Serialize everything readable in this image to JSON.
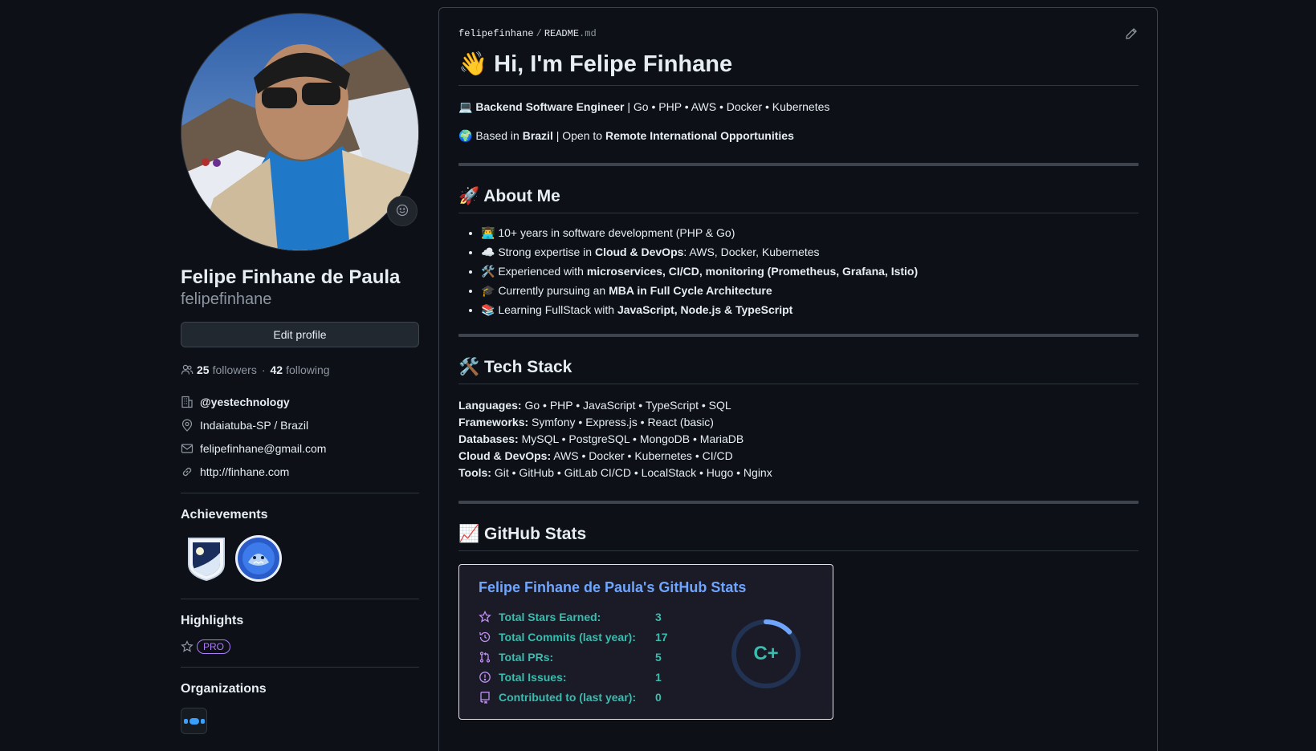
{
  "profile": {
    "full_name": "Felipe Finhane de Paula",
    "username": "felipefinhane",
    "edit_label": "Edit profile",
    "followers_count": "25",
    "followers_label": "followers",
    "following_count": "42",
    "following_label": "following",
    "separator": "·",
    "organization": "@yestechnology",
    "location": "Indaiatuba-SP / Brazil",
    "email": "felipefinhane@gmail.com",
    "website": "http://finhane.com"
  },
  "achievements": {
    "title": "Achievements"
  },
  "highlights": {
    "title": "Highlights",
    "pro_label": "PRO"
  },
  "organizations": {
    "title": "Organizations"
  },
  "readme": {
    "owner": "felipefinhane",
    "slash": "/",
    "file_name": "README",
    "file_ext": ".md",
    "heading": "👋 Hi, I'm Felipe Finhane",
    "line1_icon": "💻",
    "line1_bold": "Backend Software Engineer",
    "line1_rest": " | Go • PHP • AWS • Docker • Kubernetes",
    "line2_icon": "🌍",
    "line2_pre": " Based in ",
    "line2_bold1": "Brazil",
    "line2_mid": " | Open to ",
    "line2_bold2": "Remote International Opportunities",
    "about_heading": "🚀 About Me",
    "about": [
      {
        "pre": "👨‍💻 10+ years in software development (PHP & Go)",
        "bold": "",
        "post": ""
      },
      {
        "pre": "☁️ Strong expertise in ",
        "bold": "Cloud & DevOps",
        "post": ": AWS, Docker, Kubernetes"
      },
      {
        "pre": "🛠️ Experienced with ",
        "bold": "microservices, CI/CD, monitoring (Prometheus, Grafana, Istio)",
        "post": ""
      },
      {
        "pre": "🎓 Currently pursuing an ",
        "bold": "MBA in Full Cycle Architecture",
        "post": ""
      },
      {
        "pre": "📚 Learning FullStack with ",
        "bold": "JavaScript, Node.js & TypeScript",
        "post": ""
      }
    ],
    "tech_heading": "🛠️ Tech Stack",
    "tech": [
      {
        "label": "Languages:",
        "value": " Go • PHP • JavaScript • TypeScript • SQL"
      },
      {
        "label": "Frameworks:",
        "value": " Symfony • Express.js • React (basic)"
      },
      {
        "label": "Databases:",
        "value": " MySQL • PostgreSQL • MongoDB • MariaDB"
      },
      {
        "label": "Cloud & DevOps:",
        "value": " AWS • Docker • Kubernetes • CI/CD"
      },
      {
        "label": "Tools:",
        "value": " Git • GitHub • GitLab CI/CD • LocalStack • Hugo • Nginx"
      }
    ],
    "stats_heading": "📈 GitHub Stats"
  },
  "stats_card": {
    "title": "Felipe Finhane de Paula's GitHub Stats",
    "rows": [
      {
        "icon": "star-icon",
        "label": "Total Stars Earned:",
        "value": "3"
      },
      {
        "icon": "history-icon",
        "label": "Total Commits (last year):",
        "value": "17"
      },
      {
        "icon": "pull-request-icon",
        "label": "Total PRs:",
        "value": "5"
      },
      {
        "icon": "issue-icon",
        "label": "Total Issues:",
        "value": "1"
      },
      {
        "icon": "repo-icon",
        "label": "Contributed to (last year):",
        "value": "0"
      }
    ],
    "rank": "C+",
    "rank_progress": 0.13,
    "colors": {
      "title": "#70a5fd",
      "text": "#38bdae",
      "icon": "#bf91f3",
      "bg": "#1a1b27"
    }
  }
}
